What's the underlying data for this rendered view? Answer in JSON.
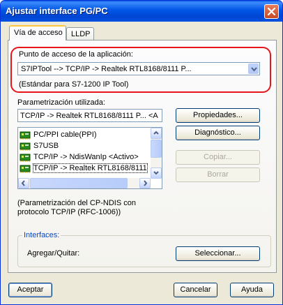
{
  "window": {
    "title": "Ajustar interface PG/PC"
  },
  "tabs": [
    {
      "label": "Vía de acceso"
    },
    {
      "label": "LLDP"
    }
  ],
  "access_point": {
    "label": "Punto de acceso de la aplicación:",
    "value": "S7IPTool       --> TCP/IP -> Realtek RTL8168/8111 P...",
    "note": "(Estándar para S7-1200 IP Tool)"
  },
  "parametrization": {
    "label": "Parametrización utilizada:",
    "value": "TCP/IP -> Realtek RTL8168/8111 P...  <A",
    "items": [
      {
        "label": "PC/PPI cable(PPI)",
        "selected": false
      },
      {
        "label": "S7USB",
        "selected": false
      },
      {
        "label": "TCP/IP -> NdisWanIp  <Activo>",
        "selected": false
      },
      {
        "label": "TCP/IP -> Realtek RTL8168/8111",
        "selected": true
      }
    ],
    "description": "(Parametrización del CP-NDIS con protocolo TCP/IP (RFC-1006))"
  },
  "side_buttons": {
    "properties": "Propiedades...",
    "diagnostics": "Diagnóstico...",
    "copy": "Copiar...",
    "delete": "Borrar"
  },
  "interfaces": {
    "legend": "Interfaces:",
    "label": "Agregar/Quitar:",
    "select_button": "Seleccionar..."
  },
  "footer": {
    "accept": "Aceptar",
    "cancel": "Cancelar",
    "help": "Ayuda"
  },
  "icons": {
    "close": "close-icon",
    "dropdown": "chevron-down-icon",
    "list_item": "network-card-icon"
  },
  "colors": {
    "titlebar": "#0055e5",
    "highlight_border": "#e5151b",
    "dialog_bg": "#ece9d8",
    "group_legend": "#0046d5"
  }
}
